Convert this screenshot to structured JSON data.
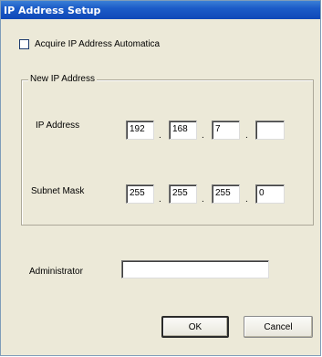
{
  "window": {
    "title": "IP Address Setup"
  },
  "auto": {
    "label": "Acquire IP Address Automatica",
    "checked": false
  },
  "group": {
    "legend": "New IP Address"
  },
  "ip": {
    "label": "IP Address",
    "octets": [
      "192",
      "168",
      "7",
      ""
    ]
  },
  "subnet": {
    "label": "Subnet Mask",
    "octets": [
      "255",
      "255",
      "255",
      "0"
    ]
  },
  "dot": ".",
  "admin": {
    "label": "Administrator",
    "value": ""
  },
  "buttons": {
    "ok": "OK",
    "cancel": "Cancel"
  }
}
